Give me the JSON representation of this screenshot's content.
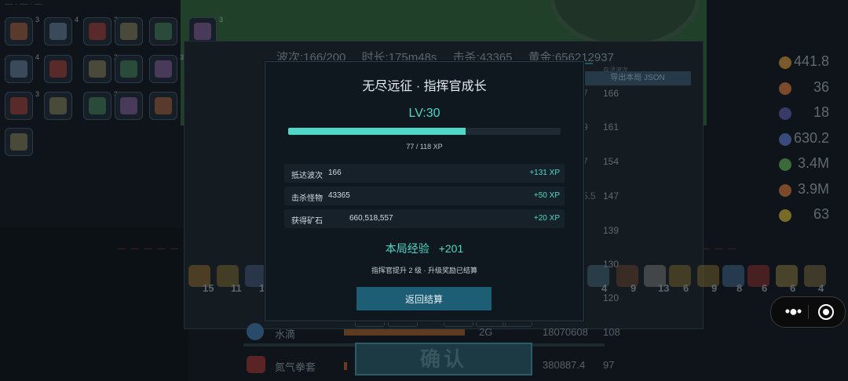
{
  "background": {
    "stats": {
      "wave": "波次:166/200",
      "duration": "时长:175m48s",
      "kills": "击杀:43365",
      "gold": "黄金:656212937"
    },
    "export_header": "存活波次",
    "export_button": "导出本局 JSON",
    "inventory_counts": [
      "3",
      "4",
      "3",
      "",
      "",
      "3",
      "4",
      "",
      "2",
      "",
      "3",
      "6",
      "3",
      "",
      "3",
      "",
      "",
      ""
    ],
    "resources": [
      "441.8",
      "36",
      "18",
      "630.2",
      "3.4M",
      "3.9M",
      "63"
    ],
    "wave_column": [
      "166",
      "161",
      "154",
      "147",
      "139",
      "130",
      "120",
      "108",
      "97"
    ],
    "side_column": [
      "7",
      "9",
      "7",
      "5.5"
    ],
    "icon_row_counts": [
      "15",
      "11",
      "11",
      "4",
      "9",
      "13",
      "6",
      "9",
      "8",
      "6",
      "6",
      "4"
    ],
    "tower_rows": [
      {
        "name": "水滴",
        "level": "2G",
        "damage": "18070608",
        "wave": "108"
      },
      {
        "name": "氮气拳套",
        "level": "",
        "damage": "380887.4",
        "wave": "97"
      }
    ],
    "confirm_button": "确认"
  },
  "modal": {
    "title": "无尽远征 · 指挥官成长",
    "level": "LV:30",
    "xp_current": 77,
    "xp_max": 118,
    "xp_text": "77 / 118 XP",
    "rows": [
      {
        "label": "抵达波次",
        "value": "166",
        "xp": "+131 XP"
      },
      {
        "label": "击杀怪物",
        "value": "43365",
        "xp": "+50 XP"
      },
      {
        "label": "获得矿石",
        "value": "660,518,557",
        "xp": "+20 XP"
      }
    ],
    "gain_label": "本局经验",
    "gain_value": "+201",
    "note": "指挥官提升 2 级 · 升级奖励已结算",
    "back_button": "返回结算"
  },
  "capsule": {
    "more_glyph": "•●•",
    "close_icon": "record-circle-icon"
  },
  "colors": {
    "accent": "#4fd8c8",
    "button": "#1e5e75",
    "modal_bg": "#0f171f",
    "page_bg": "#0e1419"
  }
}
